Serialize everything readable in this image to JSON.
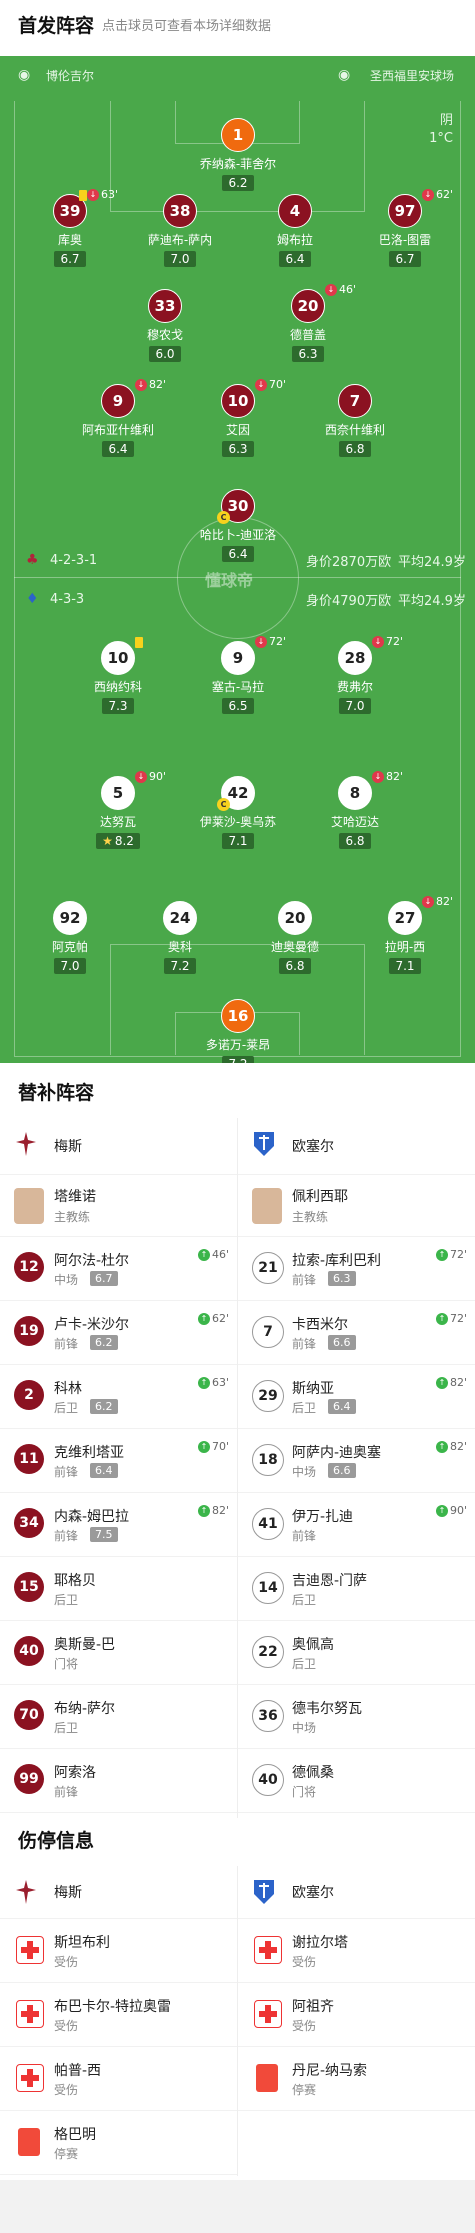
{
  "header": {
    "title": "首发阵容",
    "hint": "点击球员可查看本场详细数据"
  },
  "teams": {
    "home": "博伦吉尔",
    "away": "圣西福里安球场"
  },
  "weather": {
    "condition": "阴",
    "temp": "1°C"
  },
  "watermark": "懂球帝",
  "home_formation": {
    "formation": "4-2-3-1",
    "value": "身价2870万欧",
    "age": "平均24.9岁"
  },
  "away_formation": {
    "formation": "4-3-3",
    "value": "身价4790万欧",
    "age": "平均24.9岁"
  },
  "home_players": [
    {
      "num": "1",
      "name": "乔纳森-菲舍尔",
      "rating": "6.2",
      "gk": true
    },
    {
      "num": "39",
      "name": "库奥",
      "rating": "6.7",
      "event": "63'",
      "yellow": true
    },
    {
      "num": "38",
      "name": "萨迪布-萨内",
      "rating": "7.0"
    },
    {
      "num": "4",
      "name": "姆布拉",
      "rating": "6.4"
    },
    {
      "num": "97",
      "name": "巴洛-图雷",
      "rating": "6.7",
      "event": "62'"
    },
    {
      "num": "33",
      "name": "穆农戈",
      "rating": "6.0"
    },
    {
      "num": "20",
      "name": "德普盖",
      "rating": "6.3",
      "event": "46'"
    },
    {
      "num": "9",
      "name": "阿布亚什维利",
      "rating": "6.4",
      "event": "82'"
    },
    {
      "num": "10",
      "name": "艾因",
      "rating": "6.3",
      "event": "70'"
    },
    {
      "num": "7",
      "name": "西奈什维利",
      "rating": "6.8"
    },
    {
      "num": "30",
      "name": "哈比卜-迪亚洛",
      "rating": "6.4",
      "captain": "C"
    }
  ],
  "away_players": [
    {
      "num": "10",
      "name": "西纳约科",
      "rating": "7.3",
      "yellow": true
    },
    {
      "num": "9",
      "name": "塞古-马拉",
      "rating": "6.5",
      "event": "72'"
    },
    {
      "num": "28",
      "name": "费弗尔",
      "rating": "7.0",
      "event": "72'"
    },
    {
      "num": "5",
      "name": "达努瓦",
      "rating": "8.2",
      "event": "90'",
      "star": true
    },
    {
      "num": "42",
      "name": "伊莱沙-奥乌苏",
      "rating": "7.1",
      "captain": "C"
    },
    {
      "num": "8",
      "name": "艾哈迈达",
      "rating": "6.8",
      "event": "82'"
    },
    {
      "num": "92",
      "name": "阿克帕",
      "rating": "7.0"
    },
    {
      "num": "24",
      "name": "奥科",
      "rating": "7.2"
    },
    {
      "num": "20",
      "name": "迪奥曼德",
      "rating": "6.8"
    },
    {
      "num": "27",
      "name": "拉明-西",
      "rating": "7.1",
      "event": "82'"
    },
    {
      "num": "16",
      "name": "多诺万-莱昂",
      "rating": "7.2",
      "gk": true
    }
  ],
  "subs": {
    "title": "替补阵容",
    "home_team": "梅斯",
    "away_team": "欧塞尔",
    "home_coach": {
      "name": "塔维诺",
      "role": "主教练"
    },
    "away_coach": {
      "name": "佩利西耶",
      "role": "主教练"
    },
    "home": [
      {
        "num": "12",
        "name": "阿尔法-杜尔",
        "pos": "中场",
        "rating": "6.7",
        "event": "46'"
      },
      {
        "num": "19",
        "name": "卢卡-米沙尔",
        "pos": "前锋",
        "rating": "6.2",
        "event": "62'"
      },
      {
        "num": "2",
        "name": "科林",
        "pos": "后卫",
        "rating": "6.2",
        "event": "63'"
      },
      {
        "num": "11",
        "name": "克维利塔亚",
        "pos": "前锋",
        "rating": "6.4",
        "event": "70'"
      },
      {
        "num": "34",
        "name": "内森-姆巴拉",
        "pos": "前锋",
        "rating": "7.5",
        "event": "82'"
      },
      {
        "num": "15",
        "name": "耶格贝",
        "pos": "后卫",
        "rating": ""
      },
      {
        "num": "40",
        "name": "奥斯曼-巴",
        "pos": "门将",
        "rating": ""
      },
      {
        "num": "70",
        "name": "布纳-萨尔",
        "pos": "后卫",
        "rating": ""
      },
      {
        "num": "99",
        "name": "阿索洛",
        "pos": "前锋",
        "rating": ""
      }
    ],
    "away": [
      {
        "num": "21",
        "name": "拉索-库利巴利",
        "pos": "前锋",
        "rating": "6.3",
        "event": "72'"
      },
      {
        "num": "7",
        "name": "卡西米尔",
        "pos": "前锋",
        "rating": "6.6",
        "event": "72'"
      },
      {
        "num": "29",
        "name": "斯纳亚",
        "pos": "后卫",
        "rating": "6.4",
        "event": "82'"
      },
      {
        "num": "18",
        "name": "阿萨内-迪奥塞",
        "pos": "中场",
        "rating": "6.6",
        "event": "82'"
      },
      {
        "num": "41",
        "name": "伊万-扎迪",
        "pos": "前锋",
        "rating": "",
        "event": "90'"
      },
      {
        "num": "14",
        "name": "吉迪恩-门萨",
        "pos": "后卫",
        "rating": ""
      },
      {
        "num": "22",
        "name": "奥佩高",
        "pos": "后卫",
        "rating": ""
      },
      {
        "num": "36",
        "name": "德韦尔努瓦",
        "pos": "中场",
        "rating": ""
      },
      {
        "num": "40",
        "name": "德佩桑",
        "pos": "门将",
        "rating": ""
      }
    ]
  },
  "injuries": {
    "title": "伤停信息",
    "home": [
      {
        "name": "斯坦布利",
        "status": "受伤"
      },
      {
        "name": "布巴卡尔-特拉奥雷",
        "status": "受伤"
      },
      {
        "name": "帕普-西",
        "status": "受伤"
      },
      {
        "name": "格巴明",
        "status": "停赛"
      }
    ],
    "away": [
      {
        "name": "谢拉尔塔",
        "status": "受伤"
      },
      {
        "name": "阿祖齐",
        "status": "受伤"
      },
      {
        "name": "丹尼-纳马索",
        "status": "停赛"
      }
    ]
  }
}
